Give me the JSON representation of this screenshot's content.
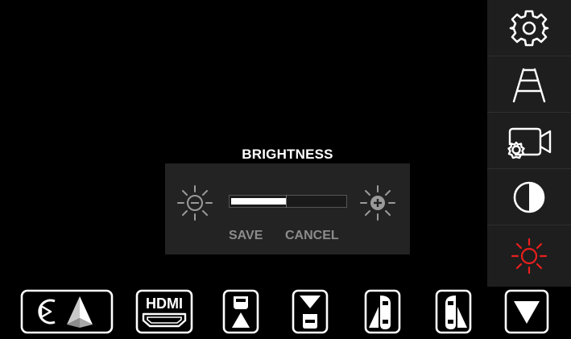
{
  "sidebar": {
    "items": [
      {
        "icon": "gear-icon",
        "color": "#ffffff"
      },
      {
        "icon": "road-lines-icon",
        "color": "#ffffff"
      },
      {
        "icon": "camera-settings-icon",
        "color": "#ffffff"
      },
      {
        "icon": "contrast-icon",
        "color": "#ffffff"
      },
      {
        "icon": "brightness-icon",
        "color": "#e8201e",
        "active": true
      }
    ]
  },
  "brightness_dialog": {
    "title": "BRIGHTNESS",
    "level_fraction": 0.48,
    "save_label": "SAVE",
    "cancel_label": "CANCEL",
    "decrease_icon": "brightness-decrease-icon",
    "increase_icon": "brightness-increase-icon"
  },
  "bottom_bar": {
    "items": [
      {
        "icon": "carplay-android-auto-icon"
      },
      {
        "icon": "hdmi-icon",
        "label": "HDMI"
      },
      {
        "icon": "front-camera-view-icon"
      },
      {
        "icon": "front-rear-camera-view-icon"
      },
      {
        "icon": "left-side-camera-view-icon"
      },
      {
        "icon": "right-side-camera-view-icon"
      },
      {
        "icon": "chevron-down-icon"
      }
    ]
  },
  "colors": {
    "background": "#000000",
    "sidebar": "#1e1e1e",
    "dialog": "#232323",
    "accent_active": "#e8201e",
    "inactive_text": "#8c8c8c"
  }
}
